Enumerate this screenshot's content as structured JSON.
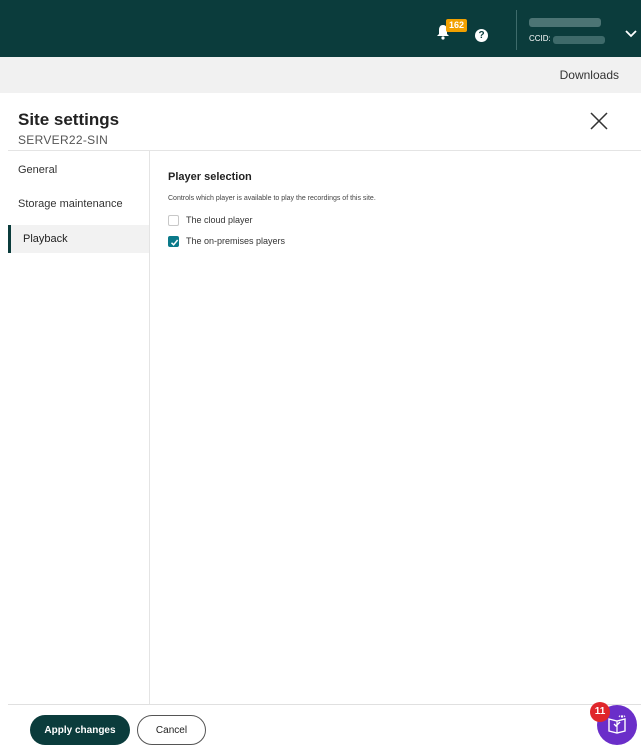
{
  "topbar": {
    "notification_count": "162",
    "help_symbol": "?",
    "ccid_label": "CCID:",
    "icons": [
      "bell-icon",
      "help-icon",
      "chevron-down-icon"
    ],
    "colors": {
      "background": "#0b3c3c",
      "badge": "#f2a100"
    }
  },
  "subbar": {
    "downloads_label": "Downloads"
  },
  "panel": {
    "title": "Site settings",
    "subtitle": "SERVER22-SIN",
    "close_icon": "close-icon"
  },
  "sidebar": {
    "items": [
      {
        "label": "General",
        "active": false
      },
      {
        "label": "Storage maintenance",
        "active": false
      },
      {
        "label": "Playback",
        "active": true
      }
    ]
  },
  "main": {
    "section_title": "Player selection",
    "description": "Controls which player is available to play the recordings of this site.",
    "options": [
      {
        "label": "The cloud player",
        "checked": false
      },
      {
        "label": "The on-premises players",
        "checked": true
      }
    ]
  },
  "footer": {
    "apply_label": "Apply changes",
    "cancel_label": "Cancel",
    "widget_badge": "11",
    "widget_icon": "guide-book-icon",
    "colors": {
      "primary": "#0b3c3c",
      "widget": "#6a2ec9",
      "widget_badge": "#e0262b"
    }
  }
}
